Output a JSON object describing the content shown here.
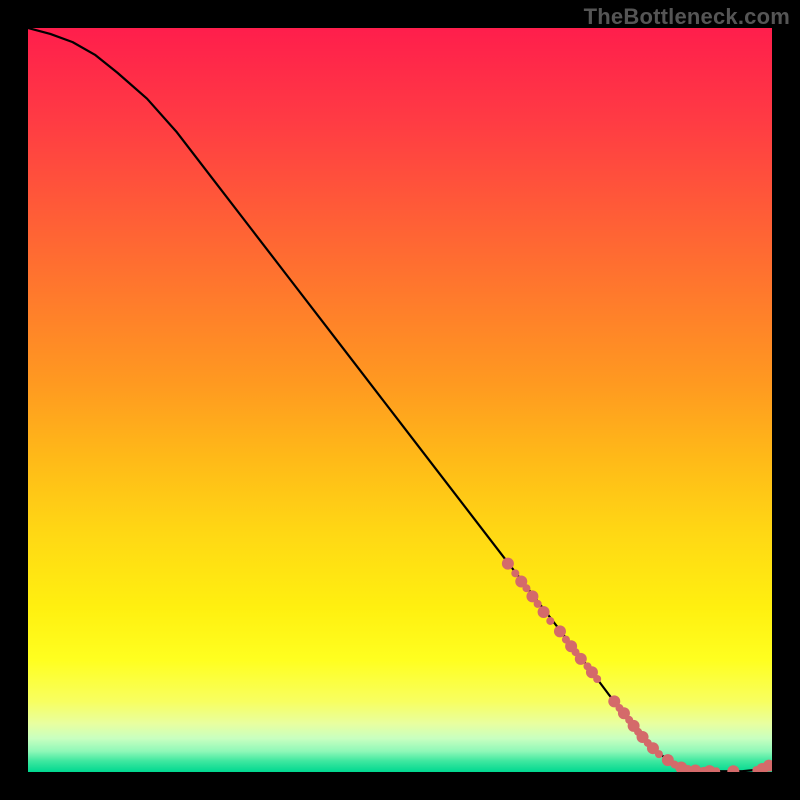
{
  "watermark": "TheBottleneck.com",
  "chart_data": {
    "type": "line",
    "title": "",
    "xlabel": "",
    "ylabel": "",
    "xlim": [
      0,
      100
    ],
    "ylim": [
      0,
      100
    ],
    "grid": false,
    "legend": false,
    "series": [
      {
        "name": "curve",
        "x": [
          0,
          3,
          6,
          9,
          12,
          16,
          20,
          25,
          30,
          35,
          40,
          45,
          50,
          55,
          60,
          65,
          70,
          75,
          78,
          80,
          82,
          84,
          86,
          88,
          90,
          92,
          94,
          96,
          98,
          100
        ],
        "y": [
          100,
          99.2,
          98.1,
          96.4,
          94.0,
          90.5,
          86.0,
          79.5,
          73.0,
          66.5,
          60.0,
          53.5,
          47.0,
          40.5,
          34.0,
          27.5,
          21.0,
          14.5,
          10.5,
          8.0,
          5.4,
          3.2,
          1.6,
          0.6,
          0.2,
          0.1,
          0.1,
          0.1,
          0.3,
          0.9
        ]
      }
    ],
    "scatter": [
      {
        "name": "dots",
        "color": "#d46a6a",
        "radius_small": 4,
        "radius_large": 6,
        "points": [
          {
            "x": 64.5,
            "y": 28.0,
            "r": 6
          },
          {
            "x": 65.5,
            "y": 26.7,
            "r": 4
          },
          {
            "x": 66.3,
            "y": 25.6,
            "r": 6
          },
          {
            "x": 67.0,
            "y": 24.7,
            "r": 4
          },
          {
            "x": 67.8,
            "y": 23.6,
            "r": 6
          },
          {
            "x": 68.5,
            "y": 22.6,
            "r": 4
          },
          {
            "x": 69.3,
            "y": 21.5,
            "r": 6
          },
          {
            "x": 70.2,
            "y": 20.3,
            "r": 4
          },
          {
            "x": 71.5,
            "y": 18.9,
            "r": 6
          },
          {
            "x": 72.3,
            "y": 17.8,
            "r": 4
          },
          {
            "x": 73.0,
            "y": 16.9,
            "r": 6
          },
          {
            "x": 73.6,
            "y": 16.1,
            "r": 4
          },
          {
            "x": 74.3,
            "y": 15.2,
            "r": 6
          },
          {
            "x": 75.2,
            "y": 14.2,
            "r": 4
          },
          {
            "x": 75.8,
            "y": 13.4,
            "r": 6
          },
          {
            "x": 76.5,
            "y": 12.5,
            "r": 4
          },
          {
            "x": 78.8,
            "y": 9.5,
            "r": 6
          },
          {
            "x": 79.5,
            "y": 8.6,
            "r": 4
          },
          {
            "x": 80.1,
            "y": 7.9,
            "r": 6
          },
          {
            "x": 80.8,
            "y": 7.0,
            "r": 4
          },
          {
            "x": 81.4,
            "y": 6.2,
            "r": 6
          },
          {
            "x": 82.0,
            "y": 5.4,
            "r": 4
          },
          {
            "x": 82.6,
            "y": 4.7,
            "r": 6
          },
          {
            "x": 83.3,
            "y": 3.9,
            "r": 4
          },
          {
            "x": 84.0,
            "y": 3.2,
            "r": 6
          },
          {
            "x": 84.8,
            "y": 2.4,
            "r": 4
          },
          {
            "x": 86.0,
            "y": 1.6,
            "r": 6
          },
          {
            "x": 86.9,
            "y": 1.0,
            "r": 4
          },
          {
            "x": 87.8,
            "y": 0.6,
            "r": 6
          },
          {
            "x": 88.7,
            "y": 0.4,
            "r": 4
          },
          {
            "x": 89.7,
            "y": 0.2,
            "r": 6
          },
          {
            "x": 90.8,
            "y": 0.15,
            "r": 4
          },
          {
            "x": 91.6,
            "y": 0.12,
            "r": 6
          },
          {
            "x": 92.5,
            "y": 0.1,
            "r": 4
          },
          {
            "x": 94.8,
            "y": 0.1,
            "r": 6
          },
          {
            "x": 97.9,
            "y": 0.25,
            "r": 4
          },
          {
            "x": 98.7,
            "y": 0.4,
            "r": 6
          },
          {
            "x": 99.6,
            "y": 0.85,
            "r": 6
          }
        ]
      }
    ],
    "background_gradient": {
      "stops": [
        {
          "offset": 0.0,
          "color": "#ff1e4c"
        },
        {
          "offset": 0.12,
          "color": "#ff3a44"
        },
        {
          "offset": 0.24,
          "color": "#ff5a38"
        },
        {
          "offset": 0.36,
          "color": "#ff7a2c"
        },
        {
          "offset": 0.48,
          "color": "#ff9a20"
        },
        {
          "offset": 0.58,
          "color": "#ffba18"
        },
        {
          "offset": 0.68,
          "color": "#ffd814"
        },
        {
          "offset": 0.78,
          "color": "#fff010"
        },
        {
          "offset": 0.85,
          "color": "#ffff20"
        },
        {
          "offset": 0.905,
          "color": "#f8ff60"
        },
        {
          "offset": 0.935,
          "color": "#e8ffa0"
        },
        {
          "offset": 0.955,
          "color": "#c8ffc0"
        },
        {
          "offset": 0.972,
          "color": "#90f8b8"
        },
        {
          "offset": 0.985,
          "color": "#40e8a0"
        },
        {
          "offset": 1.0,
          "color": "#00d890"
        }
      ]
    }
  }
}
